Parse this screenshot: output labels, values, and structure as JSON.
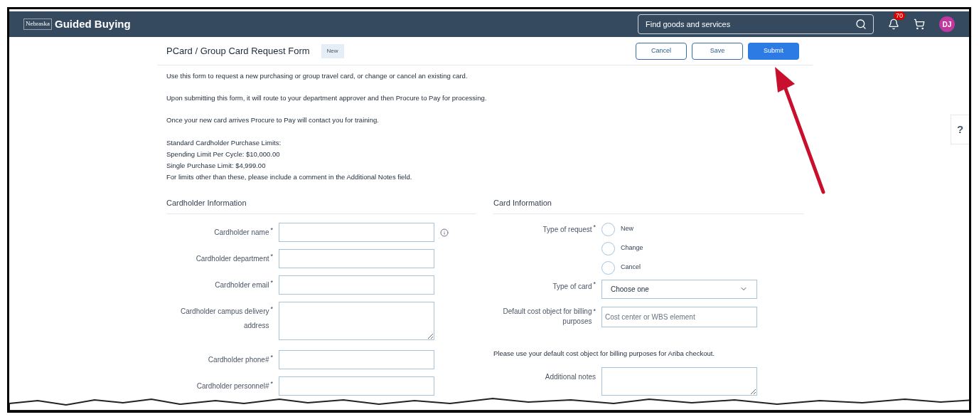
{
  "header": {
    "logo": "Nebraska",
    "title": "Guided Buying",
    "search": {
      "placeholder": "Find goods and services"
    },
    "notification_count": "70",
    "avatar": "DJ"
  },
  "form": {
    "title": "PCard / Group Card Request Form",
    "status": "New",
    "buttons": [
      {
        "label": "Cancel",
        "kind": "secondary"
      },
      {
        "label": "Save",
        "kind": "secondary"
      },
      {
        "label": "Submit",
        "kind": "primary"
      }
    ],
    "intro": [
      "Use this form to request a new purchasing or group travel card, or change or cancel an existing card.",
      "Upon submitting this form, it will route to your department approver and then Procure to Pay for processing.",
      "Once your new card arrives Procure to Pay will contact you for training."
    ],
    "limits": [
      "Standard Cardholder Purchase Limits:",
      "Spending Limit Per Cycle: $10,000.00",
      "Single Purchase Limit: $4,999.00",
      "For limits other than these, please include a comment in the Additional Notes field."
    ],
    "cardholder": {
      "heading": "Cardholder Information",
      "fields": [
        {
          "label": "Cardholder name",
          "kind": "text_info",
          "required_mark": "*"
        },
        {
          "label": "Cardholder department",
          "kind": "text",
          "required_mark": "*"
        },
        {
          "label": "Cardholder email",
          "kind": "text",
          "required_mark": "*"
        },
        {
          "label": "Cardholder campus delivery address",
          "kind": "textarea",
          "required_mark": "*"
        },
        {
          "label": "Cardholder phone#",
          "kind": "text",
          "required_mark": "*"
        },
        {
          "label": "Cardholder personnel#",
          "kind": "text",
          "required_mark": "*"
        }
      ]
    },
    "card": {
      "heading": "Card Information",
      "type_of_request": {
        "label": "Type of request",
        "required_mark": "*",
        "options": [
          {
            "label": "New",
            "selected": false
          },
          {
            "label": "Change",
            "selected": false
          },
          {
            "label": "Cancel",
            "selected": false
          }
        ]
      },
      "type_of_card": {
        "label": "Type of card",
        "required_mark": "*",
        "value": "Choose one"
      },
      "cost_object": {
        "label": "Default cost object for billing purposes",
        "required_mark": "*",
        "placeholder": "Cost center or WBS element"
      },
      "note": "Please use your default cost object for billing purposes for Ariba checkout.",
      "additional_notes": {
        "label": "Additional notes"
      }
    }
  },
  "help": "?"
}
